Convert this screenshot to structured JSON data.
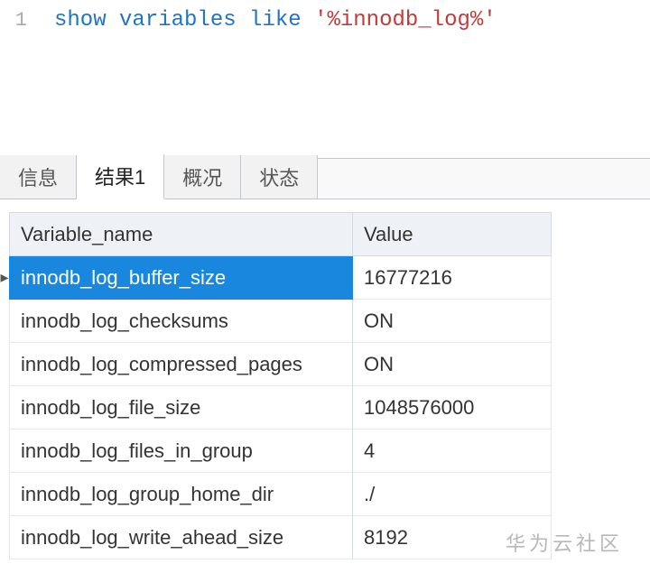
{
  "sql": {
    "line_number": "1",
    "kw_show": "show",
    "kw_variables": "variables",
    "kw_like": "like",
    "literal": "'%innodb_log%'"
  },
  "tabs": {
    "info": "信息",
    "result1": "结果1",
    "profile": "概况",
    "status": "状态",
    "active_index": 1
  },
  "columns": {
    "name": "Variable_name",
    "value": "Value"
  },
  "rows": [
    {
      "name": "innodb_log_buffer_size",
      "value": "16777216",
      "selected": true
    },
    {
      "name": "innodb_log_checksums",
      "value": "ON",
      "selected": false
    },
    {
      "name": "innodb_log_compressed_pages",
      "value": "ON",
      "selected": false
    },
    {
      "name": "innodb_log_file_size",
      "value": "1048576000",
      "selected": false
    },
    {
      "name": "innodb_log_files_in_group",
      "value": "4",
      "selected": false
    },
    {
      "name": "innodb_log_group_home_dir",
      "value": "./",
      "selected": false
    },
    {
      "name": "innodb_log_write_ahead_size",
      "value": "8192",
      "selected": false
    }
  ],
  "watermark": "华为云社区"
}
